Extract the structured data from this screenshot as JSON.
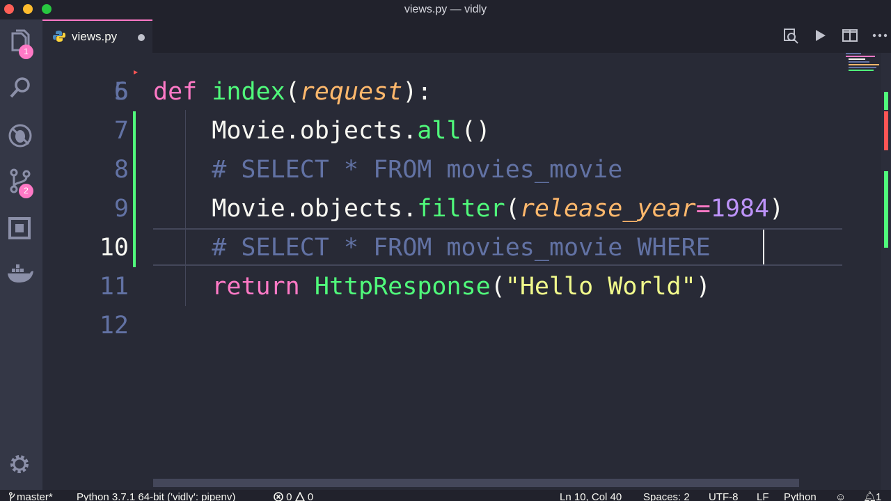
{
  "window": {
    "title": "views.py — vidly",
    "traffic_lights": [
      "#ff5f57",
      "#febc2e",
      "#28c840"
    ]
  },
  "activity_bar": {
    "explorer_badge": "1",
    "scm_badge": "2",
    "items": [
      "files-icon",
      "search-icon",
      "debug-icon",
      "source-control-icon",
      "extensions-icon",
      "docker-icon",
      "settings-gear-icon"
    ]
  },
  "tab": {
    "filename": "views.py",
    "modified": true
  },
  "editor": {
    "partial_line_number": "5",
    "lines": [
      {
        "number": "6",
        "tokens": [
          {
            "t": "def",
            "c": "kw"
          },
          {
            "t": " ",
            "c": "p"
          },
          {
            "t": "index",
            "c": "fn"
          },
          {
            "t": "(",
            "c": "p"
          },
          {
            "t": "request",
            "c": "param"
          },
          {
            "t": "):",
            "c": "p"
          }
        ]
      },
      {
        "number": "7",
        "tokens": [
          {
            "t": "    Movie.objects.",
            "c": "p"
          },
          {
            "t": "all",
            "c": "fn"
          },
          {
            "t": "()",
            "c": "p"
          }
        ]
      },
      {
        "number": "8",
        "tokens": [
          {
            "t": "    # SELECT * FROM movies_movie",
            "c": "cmt"
          }
        ]
      },
      {
        "number": "9",
        "tokens": [
          {
            "t": "    Movie.objects.",
            "c": "p"
          },
          {
            "t": "filter",
            "c": "fn"
          },
          {
            "t": "(",
            "c": "p"
          },
          {
            "t": "release_year",
            "c": "param"
          },
          {
            "t": "=",
            "c": "kw"
          },
          {
            "t": "1984",
            "c": "num"
          },
          {
            "t": ")",
            "c": "p"
          }
        ]
      },
      {
        "number": "10",
        "tokens": [
          {
            "t": "    # SELECT * FROM movies_movie WHERE ",
            "c": "cmt"
          }
        ]
      },
      {
        "number": "11",
        "tokens": [
          {
            "t": "    ",
            "c": "p"
          },
          {
            "t": "return",
            "c": "kw"
          },
          {
            "t": " ",
            "c": "p"
          },
          {
            "t": "HttpResponse",
            "c": "fn"
          },
          {
            "t": "(",
            "c": "p"
          },
          {
            "t": "\"Hello World\"",
            "c": "str"
          },
          {
            "t": ")",
            "c": "p"
          }
        ]
      },
      {
        "number": "12",
        "tokens": []
      }
    ]
  },
  "status_bar": {
    "branch": "master*",
    "interpreter": "Python 3.7.1 64-bit ('vidly': pipenv)",
    "errors": "0",
    "warnings": "0",
    "cursor_position": "Ln 10, Col 40",
    "indent": "Spaces: 2",
    "encoding": "UTF-8",
    "eol": "LF",
    "language": "Python",
    "notifications": "1"
  }
}
